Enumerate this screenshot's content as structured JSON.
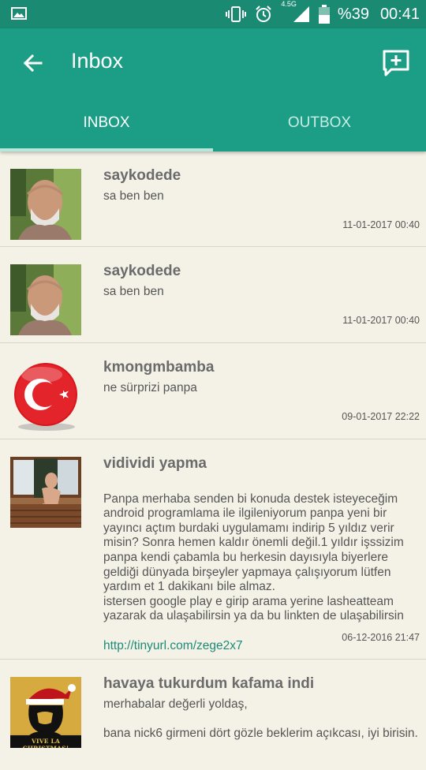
{
  "status_bar": {
    "network_type": "4.5G",
    "battery": "%39",
    "time": "00:41",
    "icons": [
      "gallery-icon",
      "vibrate-icon",
      "alarm-icon",
      "signal-icon",
      "battery-icon"
    ]
  },
  "app_bar": {
    "title": "Inbox",
    "tabs": [
      {
        "label": "INBOX",
        "selected": true
      },
      {
        "label": "OUTBOX",
        "selected": false
      }
    ],
    "accent_color": "#1b9e85",
    "status_color": "#1a8a72"
  },
  "messages": [
    {
      "sender": "saykodede",
      "preview": "sa ben ben",
      "date": "11-01-2017 00:40",
      "avatar": "man-photo"
    },
    {
      "sender": "saykodede",
      "preview": "sa ben ben",
      "date": "11-01-2017 00:40",
      "avatar": "man-photo"
    },
    {
      "sender": "kmongmbamba",
      "preview": "ne sürprizi panpa",
      "date": "09-01-2017 22:22",
      "avatar": "turkish-flag"
    },
    {
      "sender": "vidividi yapma",
      "preview": "Panpa merhaba senden bi konuda destek isteyeceğim android programlama ile ilgileniyorum panpa yeni bir yayıncı açtım burdaki uygulamamı indirip 5 yıldız verir misin? Sonra hemen kaldır önemli değil.1 yıldır işssizim panpa kendi çabamla bu herkesin dayısıyla biyerlere geldiği dünyada birşeyler yapmaya çalışıyorum lütfen yardım et 1 dakikanı bile almaz.\nistersen google play e girip arama yerine lasheatteam yazarak da ulaşabilirsin ya da bu linkten de ulaşabilirsin",
      "link": "http://tinyurl.com/zege2x7",
      "date": "06-12-2016 21:47",
      "avatar": "window-photo"
    },
    {
      "sender": "havaya tukurdum kafama indi",
      "preview": "merhabalar değerli yoldaş,\n\nbana nick6 girmeni dört gözle beklerim açıkcası, iyi birisin.",
      "date": "",
      "avatar": "christmas-poster",
      "avatar_caption": "VIVE LA CHRISTMAS!"
    }
  ]
}
